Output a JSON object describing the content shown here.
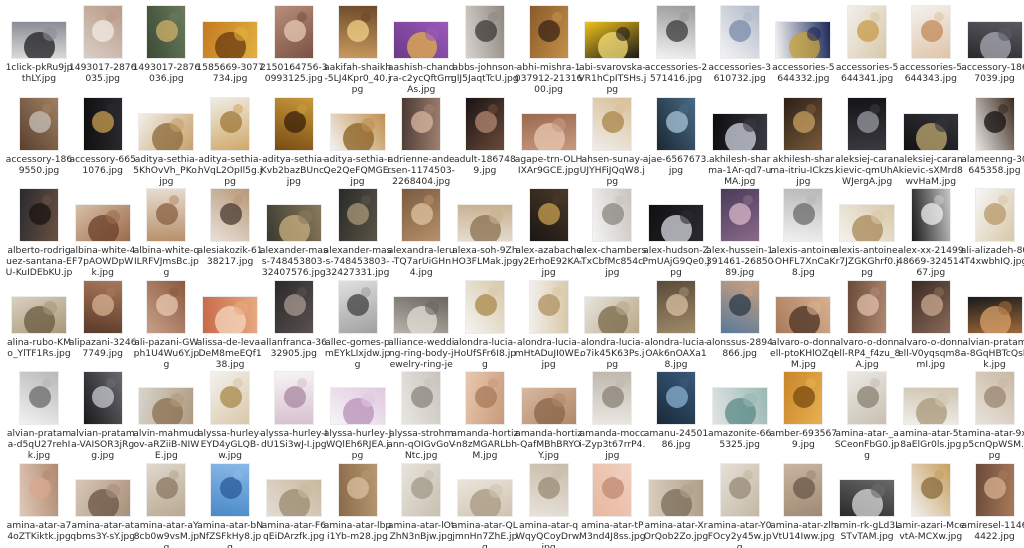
{
  "files": [
    {
      "name": "1click-pkRu9jpthLY.jpg",
      "thumb": [
        "#d8d8d6",
        "#8a8d95",
        "#1e1e22"
      ]
    },
    {
      "name": "1493017-2876035.jpg",
      "thumb": [
        "#d9cec6",
        "#b99986",
        "#f2ece6"
      ]
    },
    {
      "name": "1493017-2876036.jpg",
      "thumb": [
        "#3a4a36",
        "#6a7a5a",
        "#d2b26a"
      ]
    },
    {
      "name": "1585669-3077734.jpg",
      "thumb": [
        "#c47a20",
        "#e2b040",
        "#6a3a10"
      ]
    },
    {
      "name": "2150164756-30993125.jpg",
      "thumb": [
        "#b88e7a",
        "#7a5244",
        "#e8c8b2"
      ]
    },
    {
      "name": "aakifah-shaikh-5LJ4Kpr0_40.jpg",
      "thumb": [
        "#c99a5e",
        "#6c4a2a",
        "#f4d28a"
      ]
    },
    {
      "name": "aashish-chandra-c2ycQftGmAs.jpg",
      "thumb": [
        "#6b3a8a",
        "#9b5ab8",
        "#e6b24a"
      ]
    },
    {
      "name": "abbs-johnson-glJ5JaqtTcU.jpg",
      "thumb": [
        "#d7d2cc",
        "#8e8880",
        "#3c3a36"
      ]
    },
    {
      "name": "abhi-mishra-1037912-2131600.jpg",
      "thumb": [
        "#8a5a2a",
        "#c4904a",
        "#3a2414"
      ]
    },
    {
      "name": "abi-svarovska-VR1hCpITSHs.jpg",
      "thumb": [
        "#f0c21a",
        "#1a1a1a",
        "#f6de7a"
      ]
    },
    {
      "name": "accessories-2571416.jpg",
      "thumb": [
        "#f2f2f2",
        "#9a9a9a",
        "#3a3a3a"
      ]
    },
    {
      "name": "accessories-3610732.jpg",
      "thumb": [
        "#f4f4f4",
        "#b0b8c8",
        "#7a8aa8"
      ]
    },
    {
      "name": "accessories-5644332.jpg",
      "thumb": [
        "#f3f3f3",
        "#1c2a5a",
        "#c8a23a"
      ]
    },
    {
      "name": "accessories-5644341.jpg",
      "thumb": [
        "#f2f0ec",
        "#d8c8a8",
        "#c89a4a"
      ]
    },
    {
      "name": "accessories-5644343.jpg",
      "thumb": [
        "#f4f1ee",
        "#e0c4a8",
        "#c08a5a"
      ]
    },
    {
      "name": "accessory-1867039.jpg",
      "thumb": [
        "#2a2a2c",
        "#5a5a62",
        "#aaaab4"
      ]
    },
    {
      "name": "accessory-1869550.jpg",
      "thumb": [
        "#5a4030",
        "#a08060",
        "#c8c0b8"
      ]
    },
    {
      "name": "accessory-6651076.jpg",
      "thumb": [
        "#101012",
        "#2a2a2e",
        "#c8a050"
      ]
    },
    {
      "name": "aditya-sethia-5KhOvVh_PKo.jpg",
      "thumb": [
        "#f2eee8",
        "#c8a06a",
        "#8a6a3a"
      ]
    },
    {
      "name": "aditya-sethia-hVqL2OpIl5g.jpg",
      "thumb": [
        "#f0ece6",
        "#d0a868",
        "#a07838"
      ]
    },
    {
      "name": "aditya-sethia-Kvb2bazBUnc.jpg",
      "thumb": [
        "#7a4a14",
        "#c89a3a",
        "#3a2008"
      ]
    },
    {
      "name": "aditya-sethia-rQe2QeFQMGE.jpg",
      "thumb": [
        "#f4f2ee",
        "#c09050",
        "#8a6020"
      ]
    },
    {
      "name": "adrienne-andersen-1174503-2268404.jpg",
      "thumb": [
        "#4a3a34",
        "#a08070",
        "#d8b8a0"
      ]
    },
    {
      "name": "adult-1867489.jpg",
      "thumb": [
        "#1a1414",
        "#6a4a3a",
        "#b08870"
      ]
    },
    {
      "name": "agape-trn-OLHIXAr9GCE.jpg",
      "thumb": [
        "#9a6a50",
        "#c89880",
        "#e8c8b0"
      ]
    },
    {
      "name": "ahsen-sunay-UJYHFiJQqW8.jpg",
      "thumb": [
        "#f0ece8",
        "#d8c098",
        "#a8844a"
      ]
    },
    {
      "name": "ajae-6567673.jpg",
      "thumb": [
        "#1a2834",
        "#4a6a84",
        "#a8c4d8"
      ]
    },
    {
      "name": "akhilesh-sharma-1Ar-qd7-uMA.jpg",
      "thumb": [
        "#0c0c0e",
        "#3a3a44",
        "#d0d4e0"
      ]
    },
    {
      "name": "akhilesh-sharma-itriu-ICkzs.jpg",
      "thumb": [
        "#2a2018",
        "#7a5a38",
        "#c8a060"
      ]
    },
    {
      "name": "aleksiej-carankievic-qmUhAWJergA.jpg",
      "thumb": [
        "#141416",
        "#3a3a40",
        "#9a9aa4"
      ]
    },
    {
      "name": "aleksiej-carankievic-sXMrd8wvHaM.jpg",
      "thumb": [
        "#121214",
        "#34343a",
        "#c0a870"
      ]
    },
    {
      "name": "alameenng-30645358.jpg",
      "thumb": [
        "#e8e6e4",
        "#3a2a1e",
        "#141010"
      ]
    },
    {
      "name": "alberto-rodriguez-santana-EU-KuIDEbKU.jpg",
      "thumb": [
        "#2a2a30",
        "#6a5040",
        "#1a1410"
      ]
    },
    {
      "name": "albina-white-4F7pAOWDpWk.jpg",
      "thumb": [
        "#d8c0a8",
        "#9a6a4a",
        "#6a4028"
      ]
    },
    {
      "name": "albina-white-qILRFVJmsBc.jpg",
      "thumb": [
        "#e6dcd0",
        "#b8906a",
        "#8a6040"
      ]
    },
    {
      "name": "alesiakozik-6138217.jpg",
      "thumb": [
        "#e8e0d8",
        "#b89878",
        "#4a3a30"
      ]
    },
    {
      "name": "alexander-mass-748453803-32407576.jpg",
      "thumb": [
        "#3a3a30",
        "#8a7a5a",
        "#c8b080"
      ]
    },
    {
      "name": "alexander-mass-748453803-32427331.jpg",
      "thumb": [
        "#2a2a28",
        "#5a5448",
        "#a89878"
      ]
    },
    {
      "name": "alexandra-leru-TQ7arUiGHn4.jpg",
      "thumb": [
        "#7a5a40",
        "#b8906a",
        "#e0c4a0"
      ]
    },
    {
      "name": "alexa-soh-9ZhHO3FLMak.jpg",
      "thumb": [
        "#e4dcd0",
        "#c8b090",
        "#8a7050"
      ]
    },
    {
      "name": "alex-azabache-y2ErhoE92KA.jpg",
      "thumb": [
        "#1a1612",
        "#4a3a2a",
        "#c8a050"
      ]
    },
    {
      "name": "alex-chambers-TxCbfMc854c.jpg",
      "thumb": [
        "#f4f4f4",
        "#c8c4be",
        "#8a8680"
      ]
    },
    {
      "name": "alex-hudson-ZPmUAjG9Qe0.jpg",
      "thumb": [
        "#101012",
        "#2a2a30",
        "#d8d8e0"
      ]
    },
    {
      "name": "alex-hussein-1391461-2685089.jpg",
      "thumb": [
        "#4a3a5a",
        "#8a6a8a",
        "#d8b8c8"
      ]
    },
    {
      "name": "alexis-antoine-OHFL7XnCaK8.jpg",
      "thumb": [
        "#f0f0f0",
        "#b8b8b8",
        "#6a6a6a"
      ]
    },
    {
      "name": "alexis-antoine-r7JZGKGhrf0.jpg",
      "thumb": [
        "#f4f2ee",
        "#d8c8a8",
        "#a88858"
      ]
    },
    {
      "name": "alex-xx-2149948669-32451467.jpg",
      "thumb": [
        "#1a1a1a",
        "#c8c8c8",
        "#f0f0f0"
      ]
    },
    {
      "name": "ali-alizadeh-80-T4xwbhIQ.jpg",
      "thumb": [
        "#f6f6f6",
        "#d8c8a8",
        "#b89868"
      ]
    },
    {
      "name": "alina-rubo-KMo_YlTF1Rs.jpg",
      "thumb": [
        "#d8d0c0",
        "#a89878",
        "#6a5a40"
      ]
    },
    {
      "name": "alipazani-32467749.jpg",
      "thumb": [
        "#5a3a2a",
        "#a8785a",
        "#d8b090"
      ]
    },
    {
      "name": "ali-pazani-GWph1U4Wu6Y.jpg",
      "thumb": [
        "#c8a088",
        "#8a5a40",
        "#e8c8b0"
      ]
    },
    {
      "name": "alissa-de-leva-DeM8meEQf138.jpg",
      "thumb": [
        "#c86a4a",
        "#e8a880",
        "#f4d8c0"
      ]
    },
    {
      "name": "allanfranca-3632905.jpg",
      "thumb": [
        "#2a2a2a",
        "#5a5050",
        "#a89890"
      ]
    },
    {
      "name": "allec-gomes-pmEYkLIxjdw.jpg",
      "thumb": [
        "#e0e0e0",
        "#a0a0a0",
        "#404040"
      ]
    },
    {
      "name": "alliance-wedding-ring-body-jewelry-ring-jewellery-fashion-a...",
      "thumb": [
        "#b8b4ac",
        "#6a665e",
        "#e4e0d8"
      ]
    },
    {
      "name": "alondra-lucia-HoUfSFr6I8.jpg",
      "thumb": [
        "#f4f4f2",
        "#d8c8a8",
        "#a8884a"
      ]
    },
    {
      "name": "alondra-lucia-mHtADuJI0WE.jpg",
      "thumb": [
        "#f2f0ec",
        "#d8c8a8",
        "#b09060"
      ]
    },
    {
      "name": "alondra-lucia-o7ik45K63Ps.jpg",
      "thumb": [
        "#e8e4de",
        "#b8a888",
        "#7a6a4a"
      ]
    },
    {
      "name": "alondra-lucia-OAk6nOAXa18.jpg",
      "thumb": [
        "#5a4a38",
        "#a08a6a",
        "#d8c0a0"
      ]
    },
    {
      "name": "alonssus-2894866.jpg",
      "thumb": [
        "#5a7a9a",
        "#c8a080",
        "#2a3a4a"
      ]
    },
    {
      "name": "alvaro-o-donnell-ptoKHlOZqIM.jpg",
      "thumb": [
        "#a87a5a",
        "#d8b090",
        "#4a3024"
      ]
    },
    {
      "name": "alvaro-o-donnell-RP4_f4zu_8A.jpg",
      "thumb": [
        "#6a4a3a",
        "#b08870",
        "#e0c0a8"
      ]
    },
    {
      "name": "alvaro-o-donnell-V0yqsqm8-mI.jpg",
      "thumb": [
        "#3a2a24",
        "#8a6a58",
        "#c8a890"
      ]
    },
    {
      "name": "alvian-pratama-8GqHBTcQskk.jpg",
      "thumb": [
        "#1a1a1a",
        "#a06a3a",
        "#d8a06a"
      ]
    },
    {
      "name": "alvian-pratama-d5qU27rehIk.jpg",
      "thumb": [
        "#f2f2f2",
        "#b8b8b8",
        "#6a6a6a"
      ]
    },
    {
      "name": "alvian-pratama-VAISOR3jRgg.jpg",
      "thumb": [
        "#1a1a1c",
        "#6a6a70",
        "#c8c8d0"
      ]
    },
    {
      "name": "alvin-mahmudov-aRZiiB-NIWE.jpg",
      "thumb": [
        "#d8d4cc",
        "#b09a80",
        "#8a7050"
      ]
    },
    {
      "name": "alyssa-hurley-EYD4yGLQB-w.jpg",
      "thumb": [
        "#f4f2ee",
        "#d8c8a8",
        "#a8884a"
      ]
    },
    {
      "name": "alyssa-hurley-IdU1Si3wJ-I.jpg",
      "thumb": [
        "#f6f4f4",
        "#d8c0d0",
        "#a888a0"
      ]
    },
    {
      "name": "alyssa-hurley-JWQlEh6RJEA.jpg",
      "thumb": [
        "#f6f4f6",
        "#e0c8e0",
        "#b890b8"
      ]
    },
    {
      "name": "alyssa-strohmann-qOIGvGoVNtc.jpg",
      "thumb": [
        "#e8e6e2",
        "#c8c4bc",
        "#8a867e"
      ]
    },
    {
      "name": "amanda-hortiz-n8zMGARLbhM.jpg",
      "thumb": [
        "#e8c8b0",
        "#c89a7a",
        "#a87a5a"
      ]
    },
    {
      "name": "amanda-hortiz-QafMBhBRYOY.jpg",
      "thumb": [
        "#d8b8a0",
        "#b08868",
        "#8a6448"
      ]
    },
    {
      "name": "amanda-mocci-Zyp3t67rrP4.jpg",
      "thumb": [
        "#eae6e0",
        "#c0b8ae",
        "#8a8278"
      ]
    },
    {
      "name": "amanu-2450186.jpg",
      "thumb": [
        "#1a2a3a",
        "#3a5a7a",
        "#8ab0d0"
      ]
    },
    {
      "name": "amazonite-665325.jpg",
      "thumb": [
        "#e0e4e4",
        "#9ab8b4",
        "#5a8a86"
      ]
    },
    {
      "name": "amber-6935679.jpg",
      "thumb": [
        "#c8862a",
        "#e8b050",
        "#7a4a10"
      ]
    },
    {
      "name": "amina-atar-_aSCeonFbG0.jpg",
      "thumb": [
        "#eceae6",
        "#c8c0b0",
        "#8a8070"
      ]
    },
    {
      "name": "amina-atar-5t8aElGr0ls.jpg",
      "thumb": [
        "#f0eeea",
        "#d0c4b0",
        "#a89878"
      ]
    },
    {
      "name": "amina-atar-9xp5cnQpWSM.jpg",
      "thumb": [
        "#e8e2da",
        "#c8b8a4",
        "#9a8670"
      ]
    },
    {
      "name": "amina-atar-a74oZTKiktk.jpg",
      "thumb": [
        "#e0c8b8",
        "#b08a70",
        "#d8a890"
      ]
    },
    {
      "name": "amina-atar-atqbms3Y-sY.jpg",
      "thumb": [
        "#d8c8b8",
        "#a8907a",
        "#6a5444"
      ]
    },
    {
      "name": "amina-atar-aY8cb0w9vsM.jpg",
      "thumb": [
        "#e0d8ce",
        "#b8a890",
        "#8a7860"
      ]
    },
    {
      "name": "amina-atar-bNNfZSFkHy8.jpg",
      "thumb": [
        "#4a8ac8",
        "#8ab8e8",
        "#2a5a9a"
      ]
    },
    {
      "name": "amina-atar-F6qEiDArzfk.jpg",
      "thumb": [
        "#e4dcd2",
        "#c8b89e",
        "#9a8a70"
      ]
    },
    {
      "name": "amina-atar-lbpi1Yb-m28.jpg",
      "thumb": [
        "#8a6a4a",
        "#b89870",
        "#d8c0a0"
      ]
    },
    {
      "name": "amina-atar-lOtZhN3nBjw.jpg",
      "thumb": [
        "#e8e4dc",
        "#c8c0b0",
        "#a09888"
      ]
    },
    {
      "name": "amina-atar-QLjmnHn7ZhE.jpg",
      "thumb": [
        "#eae4dc",
        "#d0c4b0",
        "#a89a82"
      ]
    },
    {
      "name": "amina-atar-qWqyQCoyDrw.jpg",
      "thumb": [
        "#e8e2da",
        "#c8bca8",
        "#9a8c76"
      ]
    },
    {
      "name": "amina-atar-tPM3nd4J8ss.jpg",
      "thumb": [
        "#e8b8a0",
        "#f0cfc0",
        "#c08870"
      ]
    },
    {
      "name": "amina-atar-XrOrQob2Zo.jpg",
      "thumb": [
        "#d8ccbc",
        "#b0a08a",
        "#7a6c58"
      ]
    },
    {
      "name": "amina-atar-Y0FOcy2y45w.jpg",
      "thumb": [
        "#e6e0d6",
        "#c4b8a4",
        "#968a76"
      ]
    },
    {
      "name": "amina-atar-zlhVtU14Iww.jpg",
      "thumb": [
        "#c8b4a0",
        "#a08a74",
        "#6a5848"
      ]
    },
    {
      "name": "amin-rk-gLd3LSTvTAM.jpg",
      "thumb": [
        "#2a2a2a",
        "#6a6a6a",
        "#d8d8d8"
      ]
    },
    {
      "name": "amir-azari-McevtA-MCXw.jpg",
      "thumb": [
        "#f0f0ee",
        "#c8a060",
        "#8a6a3a"
      ]
    },
    {
      "name": "amiresel-11464422.jpg",
      "thumb": [
        "#6a4a3a",
        "#a87a5a",
        "#d8b090"
      ]
    }
  ]
}
